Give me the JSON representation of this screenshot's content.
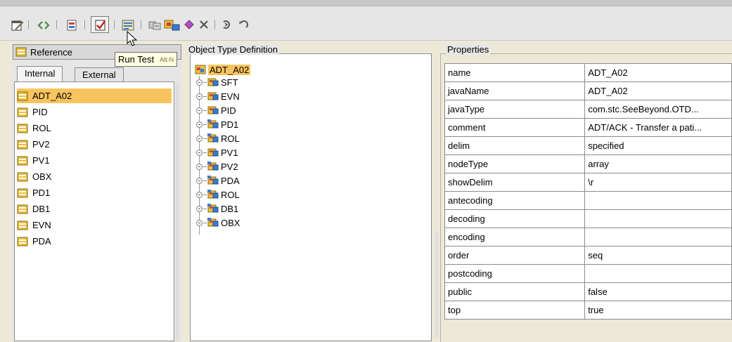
{
  "tooltip": {
    "label": "Run Test",
    "shortcut": "Alt-N"
  },
  "reference_panel": {
    "title": "Reference",
    "tabs": [
      "Internal",
      "External"
    ],
    "active_tab": "Internal",
    "items": [
      "ADT_A02",
      "PID",
      "ROL",
      "PV2",
      "PV1",
      "OBX",
      "PD1",
      "DB1",
      "EVN",
      "PDA"
    ],
    "selected": "ADT_A02"
  },
  "otd_panel": {
    "title": "Object Type Definition",
    "root": "ADT_A02",
    "nodes": [
      "SFT",
      "EVN",
      "PID",
      "PD1",
      "ROL",
      "PV1",
      "PV2",
      "PDA",
      "ROL",
      "DB1",
      "OBX"
    ]
  },
  "properties_panel": {
    "title": "Properties",
    "rows": [
      {
        "key": "name",
        "value": "ADT_A02"
      },
      {
        "key": "javaName",
        "value": "ADT_A02"
      },
      {
        "key": "javaType",
        "value": "com.stc.SeeBeyond.OTD..."
      },
      {
        "key": "comment",
        "value": "ADT/ACK - Transfer a pati..."
      },
      {
        "key": "delim",
        "value": "specified"
      },
      {
        "key": "nodeType",
        "value": "array"
      },
      {
        "key": "showDelim",
        "value": "\\r"
      },
      {
        "key": "antecoding",
        "value": ""
      },
      {
        "key": "decoding",
        "value": ""
      },
      {
        "key": "encoding",
        "value": ""
      },
      {
        "key": "order",
        "value": "seq"
      },
      {
        "key": "postcoding",
        "value": ""
      },
      {
        "key": "public",
        "value": "false"
      },
      {
        "key": "top",
        "value": "true"
      }
    ]
  },
  "toolbar": {
    "buttons": [
      "properties-icon",
      "code-view-icon",
      "import-icon",
      "run-test-icon",
      "document-icon",
      "copy-icon",
      "group-icon",
      "diamond-icon",
      "delete-icon",
      "rotate-icon",
      "undo-icon"
    ]
  },
  "colors": {
    "selection": "#f9c45f",
    "tooltip_bg": "#ffffe1",
    "panel_bg": "#e6e6e6"
  }
}
